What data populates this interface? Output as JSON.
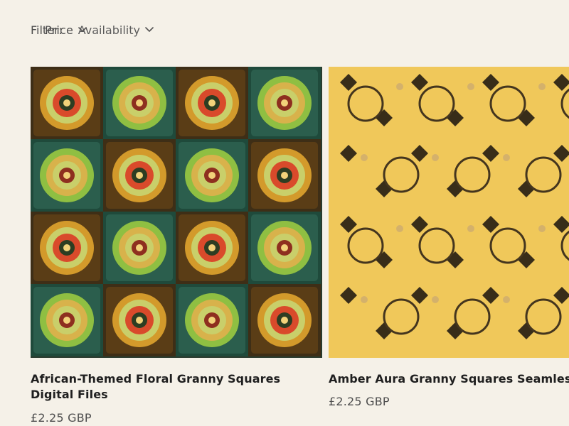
{
  "filters": {
    "label": "Filter:",
    "availability": "Availability",
    "price": "Price"
  },
  "products": [
    {
      "title": "African-Themed Floral Granny Squares Digital Files",
      "price": "£2.25 GBP"
    },
    {
      "title": "Amber Aura Granny Squares Seamless Pr",
      "price": "£2.25 GBP"
    }
  ]
}
